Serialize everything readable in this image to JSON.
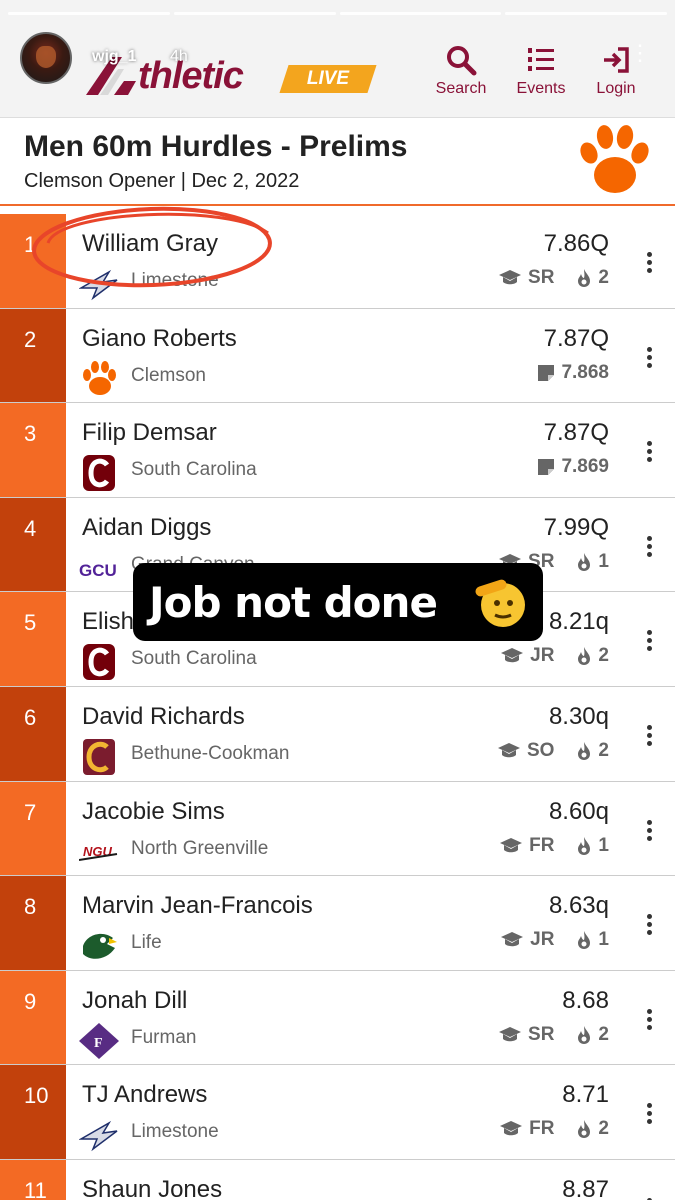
{
  "story": {
    "username": "wjg_1",
    "time": "4h",
    "caption": "Job not done",
    "caption_emoji": "saluting-face"
  },
  "header": {
    "logo_word": "thletic",
    "logo_live": "LIVE",
    "nav": [
      {
        "label": "Search",
        "icon": "search-icon"
      },
      {
        "label": "Events",
        "icon": "list-numbered-icon"
      },
      {
        "label": "Login",
        "icon": "login-icon"
      }
    ],
    "brand_color": "#8a1238"
  },
  "event": {
    "title": "Men 60m Hurdles - Prelims",
    "subtitle": "Clemson Opener | Dec 2, 2022"
  },
  "colors": {
    "place_light": "#f36a24",
    "place_dark": "#c2410c",
    "annotation": "#e8452a"
  },
  "results": [
    {
      "place": "1",
      "name": "William Gray",
      "team": "Limestone",
      "mark": "7.86Q",
      "meta_type": "class",
      "class_year": "SR",
      "heats": "2"
    },
    {
      "place": "2",
      "name": "Giano Roberts",
      "team": "Clemson",
      "mark": "7.87Q",
      "meta_type": "time",
      "precise": "7.868"
    },
    {
      "place": "3",
      "name": "Filip Demsar",
      "team": "South Carolina",
      "mark": "7.87Q",
      "meta_type": "time",
      "precise": "7.869"
    },
    {
      "place": "4",
      "name": "Aidan Diggs",
      "team": "Grand Canyon",
      "mark": "7.99Q",
      "meta_type": "class",
      "class_year": "SR",
      "heats": "1"
    },
    {
      "place": "5",
      "name": "Elisha",
      "team": "South Carolina",
      "mark": "8.21q",
      "meta_type": "class",
      "class_year": "JR",
      "heats": "2"
    },
    {
      "place": "6",
      "name": "David Richards",
      "team": "Bethune-Cookman",
      "mark": "8.30q",
      "meta_type": "class",
      "class_year": "SO",
      "heats": "2"
    },
    {
      "place": "7",
      "name": "Jacobie Sims",
      "team": "North Greenville",
      "mark": "8.60q",
      "meta_type": "class",
      "class_year": "FR",
      "heats": "1"
    },
    {
      "place": "8",
      "name": "Marvin Jean-Francois",
      "team": "Life",
      "mark": "8.63q",
      "meta_type": "class",
      "class_year": "JR",
      "heats": "1"
    },
    {
      "place": "9",
      "name": "Jonah Dill",
      "team": "Furman",
      "mark": "8.68",
      "meta_type": "class",
      "class_year": "SR",
      "heats": "2"
    },
    {
      "place": "10",
      "name": "TJ Andrews",
      "team": "Limestone",
      "mark": "8.71",
      "meta_type": "class",
      "class_year": "FR",
      "heats": "2"
    },
    {
      "place": "11",
      "name": "Shaun Jones",
      "team": "",
      "mark": "8.87",
      "meta_type": "none"
    }
  ]
}
